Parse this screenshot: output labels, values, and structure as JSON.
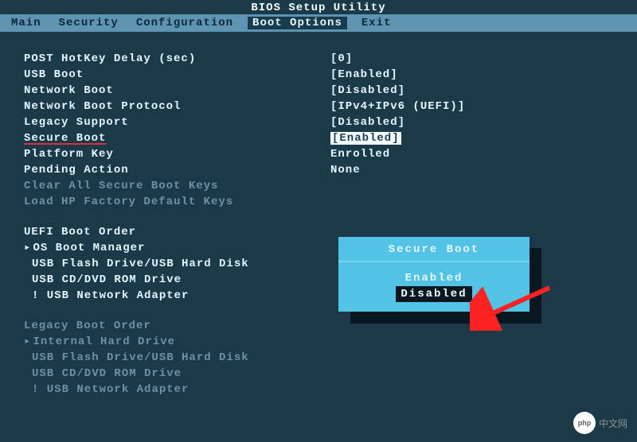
{
  "title": "BIOS Setup Utility",
  "menu": {
    "items": [
      {
        "label": "Main",
        "active": false
      },
      {
        "label": "Security",
        "active": false
      },
      {
        "label": "Configuration",
        "active": false
      },
      {
        "label": "Boot Options",
        "active": true
      },
      {
        "label": "Exit",
        "active": false
      }
    ]
  },
  "settings": [
    {
      "label": "POST HotKey Delay (sec)",
      "value": "[0]"
    },
    {
      "label": "USB Boot",
      "value": "[Enabled]"
    },
    {
      "label": "Network Boot",
      "value": "[Disabled]"
    },
    {
      "label": "Network Boot Protocol",
      "value": "[IPv4+IPv6 (UEFI)]"
    },
    {
      "label": "Legacy Support",
      "value": "[Disabled]"
    },
    {
      "label": "Secure Boot",
      "value": "[Enabled]",
      "label_underlined": true,
      "value_highlighted": true
    },
    {
      "label": "Platform Key",
      "value": "Enrolled"
    },
    {
      "label": "Pending Action",
      "value": "None"
    },
    {
      "label": "Clear All Secure Boot Keys",
      "value": "",
      "greyed": true
    },
    {
      "label": "Load HP Factory Default Keys",
      "value": "",
      "greyed": true
    }
  ],
  "uefi": {
    "header": "UEFI Boot Order",
    "items": [
      {
        "label": "OS Boot Manager",
        "triangle": true
      },
      {
        "label": "USB Flash Drive/USB Hard Disk"
      },
      {
        "label": "USB CD/DVD ROM Drive"
      },
      {
        "label": "! USB Network Adapter"
      }
    ]
  },
  "legacy": {
    "header": "Legacy Boot Order",
    "items": [
      {
        "label": "Internal Hard Drive",
        "triangle": true
      },
      {
        "label": "USB Flash Drive/USB Hard Disk"
      },
      {
        "label": "USB CD/DVD ROM Drive"
      },
      {
        "label": "! USB Network Adapter"
      }
    ]
  },
  "popup": {
    "title": "Secure Boot",
    "options": [
      {
        "label": "Enabled",
        "selected": false
      },
      {
        "label": "Disabled",
        "selected": true
      }
    ]
  },
  "watermark": {
    "logo": "php",
    "text": "中文网"
  }
}
